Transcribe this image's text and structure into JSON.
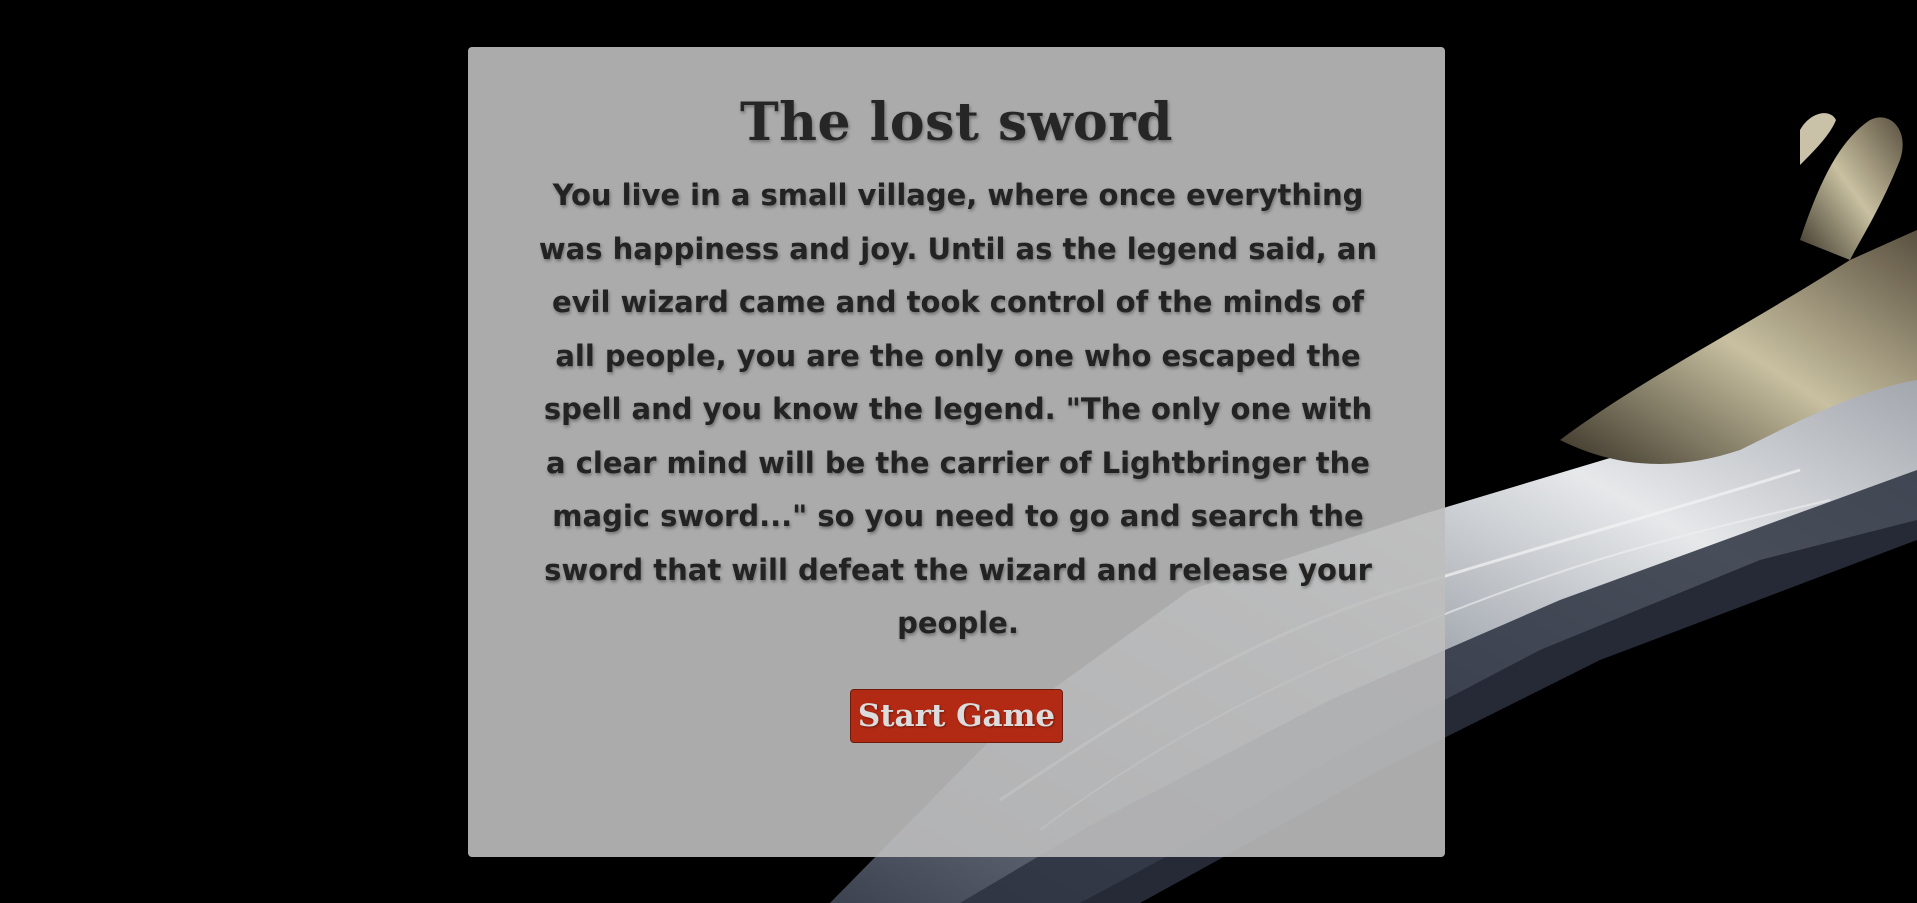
{
  "game": {
    "title": "The lost sword",
    "story": "You live in a small village, where once everything was happiness and joy. Until as the legend said, an evil wizard came and took control of the minds of all people, you are the only one who escaped the spell and you know the legend. \"The only one with a clear mind will be the carrier of Lightbringer the magic sword...\" so you need to go and search the sword that will defeat the wizard and release your people.",
    "start_button_label": "Start Game"
  },
  "colors": {
    "background": "#000000",
    "panel": "#bebebe",
    "text": "#232323",
    "button": "#b32a14",
    "button_text": "#dcdcdc"
  },
  "background_image": "sword-blade-illustration"
}
